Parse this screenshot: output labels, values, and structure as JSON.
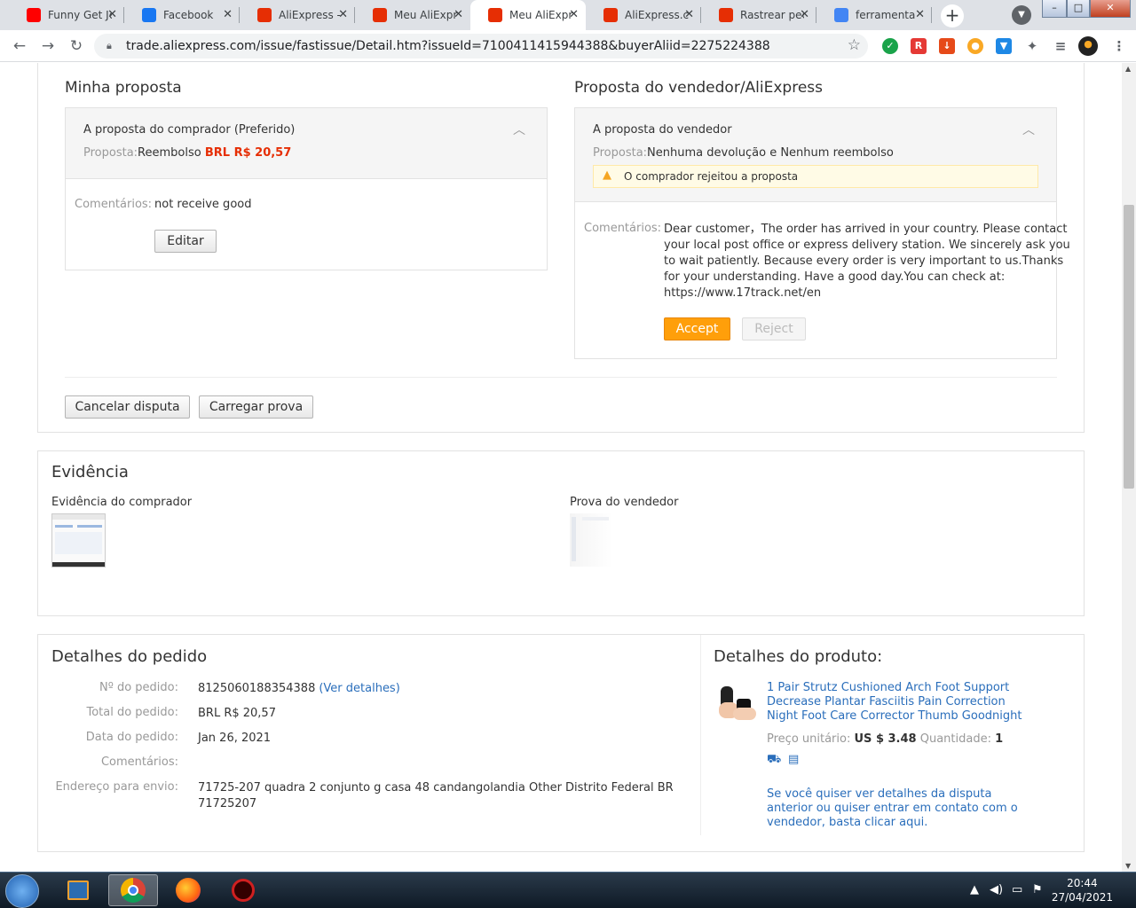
{
  "browser": {
    "tabs": [
      {
        "title": "Funny Get Je",
        "favicon": "youtube-icon",
        "color": "#ff0000"
      },
      {
        "title": "Facebook",
        "favicon": "facebook-icon",
        "color": "#1877f2"
      },
      {
        "title": "AliExpress -",
        "favicon": "aliexpress-icon",
        "color": "#e62e04"
      },
      {
        "title": "Meu AliExpr",
        "favicon": "aliexpress-icon",
        "color": "#e62e04"
      },
      {
        "title": "Meu AliExpr",
        "favicon": "aliexpress-icon",
        "color": "#e62e04"
      },
      {
        "title": "AliExpress.cc",
        "favicon": "aliexpress-icon",
        "color": "#e62e04"
      },
      {
        "title": "Rastrear pec",
        "favicon": "aliexpress-icon",
        "color": "#e62e04"
      },
      {
        "title": "ferramenta",
        "favicon": "google-icon",
        "color": "#4285f4"
      }
    ],
    "active_tab_index": 4,
    "new_tab": "+",
    "url": "trade.aliexpress.com/issue/fastissue/Detail.htm?issueId=7100411415944388&buyerAliid=2275224388"
  },
  "buyer_proposal": {
    "section_title": "Minha proposta",
    "box_title": "A proposta do comprador (Preferido)",
    "proposal_label": "Proposta:",
    "proposal_text": "Reembolso ",
    "proposal_amount": "BRL R$ 20,57",
    "comments_label": "Comentários:",
    "comments_text": "not receive good",
    "edit_button": "Editar"
  },
  "seller_proposal": {
    "section_title": "Proposta do vendedor/AliExpress",
    "box_title": "A proposta do vendedor",
    "proposal_label": "Proposta:",
    "proposal_text": "Nenhuma devolução e Nenhum reembolso",
    "warning": "O comprador rejeitou a proposta",
    "comments_label": "Comentários:",
    "comments_lines": [
      "Dear customer，The order has arrived in your country. Please contact",
      "your local post office or express delivery station. We sincerely ask you",
      "to wait patiently. Because every order is very important to us.Thanks",
      "for your understanding. Have a good day.You can check at:",
      "https://www.17track.net/en"
    ],
    "accept_button": "Accept",
    "reject_button": "Reject"
  },
  "actions": {
    "cancel_button": "Cancelar disputa",
    "upload_button": "Carregar prova"
  },
  "evidence": {
    "title": "Evidência",
    "buyer_label": "Evidência do comprador",
    "seller_label": "Prova do vendedor"
  },
  "order": {
    "title": "Detalhes do pedido",
    "rows": [
      {
        "label": "Nº do pedido:",
        "value": "8125060188354388",
        "link": "(Ver detalhes)"
      },
      {
        "label": "Total do pedido:",
        "value": "BRL R$ 20,57"
      },
      {
        "label": "Data do pedido:",
        "value": "Jan 26, 2021"
      },
      {
        "label": "Comentários:",
        "value": ""
      },
      {
        "label": "Endereço para envio:",
        "value": "71725-207 quadra 2 conjunto g casa 48 candangolandia Other Distrito Federal BR",
        "value2": "71725207"
      }
    ]
  },
  "product": {
    "title": "Detalhes do produto:",
    "name_lines": [
      "1 Pair Strutz Cushioned Arch Foot Support",
      "Decrease Plantar Fasciitis Pain Correction",
      "Night Foot Care Corrector Thumb Goodnight"
    ],
    "price_label": "Preço unitário:",
    "price": "US $ 3.48",
    "qty_label": "Quantidade:",
    "qty": "1",
    "help_lines": [
      "Se você quiser ver detalhes da disputa",
      "anterior ou quiser entrar em contato com o",
      "vendedor, basta clicar aqui."
    ]
  },
  "taskbar": {
    "time": "20:44",
    "date": "27/04/2021"
  },
  "colors": {
    "accent_orange": "#ff9f0a",
    "price_red": "#e62e04",
    "link_blue": "#2a6ebb",
    "warning_bg": "#fffbe6"
  }
}
